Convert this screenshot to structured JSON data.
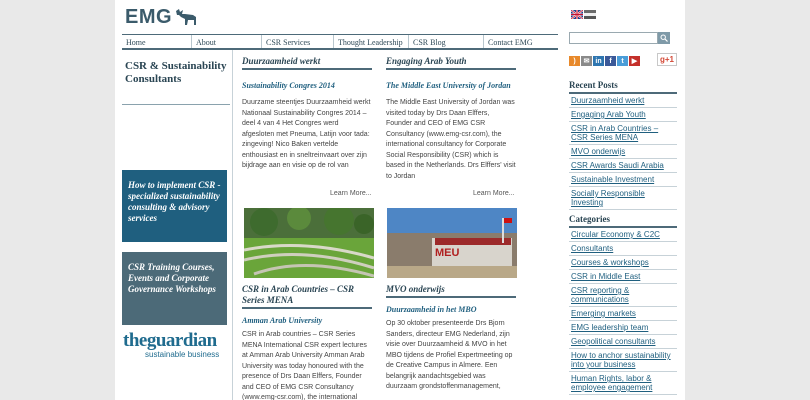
{
  "logo": {
    "text": "EMG"
  },
  "nav": [
    "Home",
    "About",
    "CSR Services",
    "Thought Leadership",
    "CSR Blog",
    "Contact EMG"
  ],
  "left": {
    "title": "CSR & Sustainability Consultants",
    "box1": "How to implement CSR - specialized sustainability consulting & advisory services",
    "box2": "CSR Training Courses, Events and Corporate Governance Workshops",
    "guardian_main": "theguardian",
    "guardian_sub": "sustainable business"
  },
  "col1": {
    "head": "Duurzaamheid werkt",
    "sub": "Sustainability Congres 2014",
    "body": "Duurzame steentjes Duurzaamheid werkt Nationaal Sustainability Congres 2014 – deel 4 van 4 Het Congres werd afgesloten met Pneuma, Latijn voor tada: zingeving! Nico Baken vertelde enthousiast en in sneltreinvaart over zijn bijdrage aan en visie op de rol van",
    "more": "Learn More...",
    "head2": "CSR in Arab Countries – CSR Series MENA",
    "sub2": "Amman Arab University",
    "body2": "CSR in Arab countries – CSR Series MENA International CSR expert lectures at Amman Arab University Amman Arab University was today honoured with the presence of Drs Daan Elffers, Founder and CEO of EMG CSR Consultancy (www.emg-csr.com), the international"
  },
  "col2": {
    "head": "Engaging Arab Youth",
    "sub": "The Middle East University of Jordan",
    "body": "The Middle East University of Jordan was visited today by Drs Daan Elffers, Founder and CEO of EMG CSR Consultancy (www.emg-csr.com), the international consultancy for Corporate Social Responsibility (CSR) which is based in the Netherlands. Drs Elffers' visit to Jordan",
    "more": "Learn More...",
    "head2": "MVO onderwijs",
    "sub2": "Duurzaamheid in het MBO",
    "body2": "Op 30 oktober presenteerde Drs Bjorn Sanders, directeur EMG Nederland, zijn visie over Duurzaamheid & MVO in het MBO tijdens de Profiel Expertmeeting op de Creative Campus in Almere. Een belangrijk aandachtsgebied was duurzaam grondstoffenmanagement,",
    "img_text": "MEU"
  },
  "right": {
    "recent_head": "Recent Posts",
    "recent": [
      "Duurzaamheid werkt",
      "Engaging Arab Youth",
      "CSR in Arab Countries – CSR Series MENA",
      "MVO onderwijs",
      "CSR Awards Saudi Arabia",
      "Sustainable Investment",
      "Socially Responsible Investing"
    ],
    "cat_head": "Categories",
    "categories": [
      "Circular Economy & C2C",
      "Consultants",
      "Courses & workshops",
      "CSR in Middle East",
      "CSR reporting & communications",
      "Emerging markets",
      "EMG leadership team",
      "Geopolitical consultants",
      "How to anchor sustainability into your business",
      "Human Rights, labor & employee engagement"
    ]
  },
  "social": {
    "gplus": "g+1"
  }
}
